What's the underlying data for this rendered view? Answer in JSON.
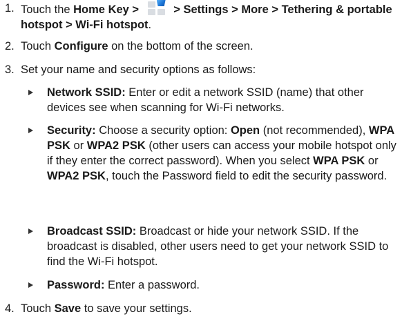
{
  "steps": {
    "s1": {
      "num": "1.",
      "a": "Touch the ",
      "b1": "Home Key > ",
      "b2": " > Settings > More > Tethering & portable hotspot > Wi-Fi hotspot",
      "c": "."
    },
    "s2": {
      "num": "2.",
      "a": "Touch ",
      "b": "Configure",
      "c": " on the bottom of the screen."
    },
    "s3": {
      "num": "3.",
      "text": "Set your name and security options as follows:"
    },
    "s4": {
      "num": "4.",
      "a": "Touch ",
      "b": "Save",
      "c": " to save your settings."
    }
  },
  "options": {
    "ssid": {
      "label": "Network SSID:",
      "text": " Enter or edit a network SSID (name) that other devices see when scanning for Wi-Fi networks."
    },
    "security": {
      "label": "Security:",
      "t1": " Choose a security option: ",
      "open": "Open",
      "t2": " (not recommended), ",
      "wpa": "WPA PSK",
      "t3": " or ",
      "wpa2": "WPA2 PSK",
      "t4": " (other users can access your mobile hotspot only if they enter the correct password). When you select ",
      "wpa_b": "WPA PSK",
      "t5": " or ",
      "wpa2_b": "WPA2 PSK",
      "t6": ", touch the Password field to edit the security password."
    },
    "broadcast": {
      "label": "Broadcast SSID:",
      "text": " Broadcast or hide your network SSID. If the broadcast is disabled, other users need to get your network SSID to find the Wi-Fi hotspot."
    },
    "password": {
      "label": "Password:",
      "text": " Enter a password."
    }
  }
}
